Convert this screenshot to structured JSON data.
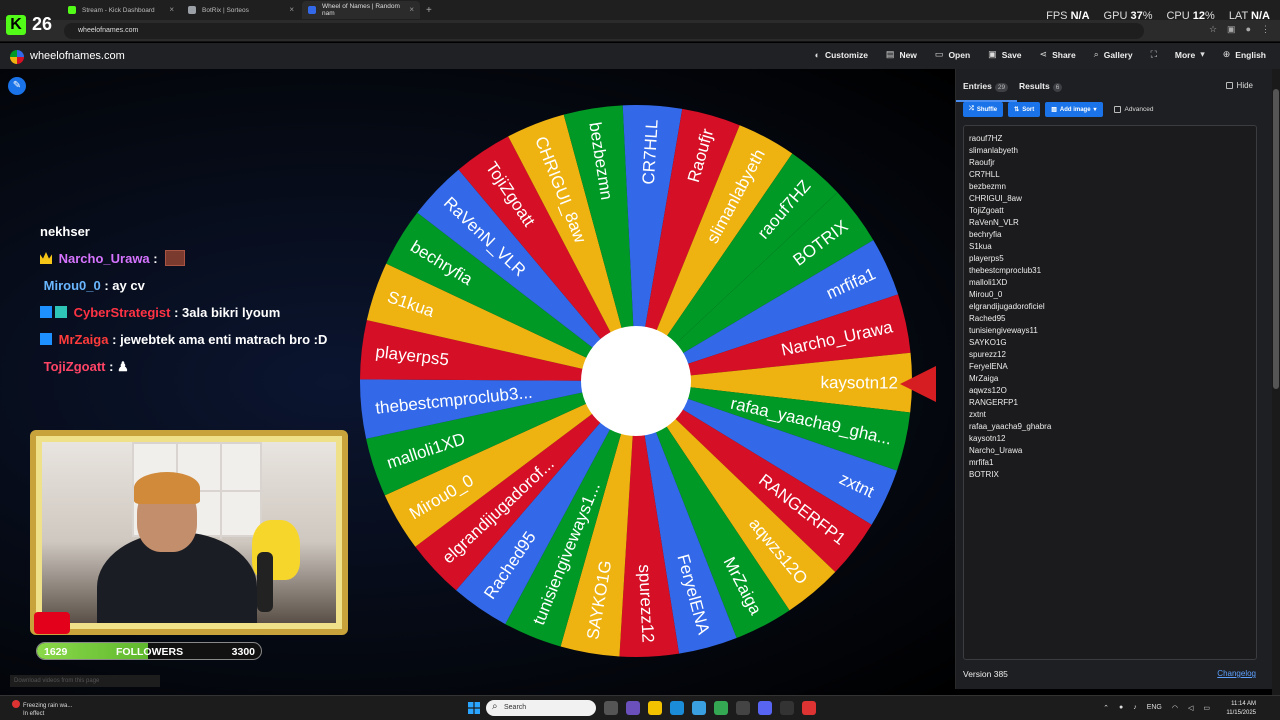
{
  "browser": {
    "tabs": [
      {
        "label": "Stream - Kick Dashboard",
        "color": "#53fc18"
      },
      {
        "label": "BotRix | Sorteos",
        "color": "#9aa0a6"
      },
      {
        "label": "Wheel of Names | Random nam",
        "color": "#3369e8"
      }
    ],
    "url": "wheelofnames.com"
  },
  "overlay": {
    "kick_logo": "K",
    "viewer_count": "26",
    "stats": {
      "fps_label": "FPS",
      "fps": "N/A",
      "gpu_label": "GPU",
      "gpu": "37",
      "cpu_label": "CPU",
      "cpu": "12",
      "pct": "%",
      "lat_label": "LAT",
      "lat": "N/A"
    }
  },
  "site": {
    "name": "wheelofnames.com",
    "nav": {
      "customize": "Customize",
      "new": "New",
      "open": "Open",
      "save": "Save",
      "share": "Share",
      "gallery": "Gallery",
      "more": "More",
      "language": "English"
    }
  },
  "chat": {
    "partial_line": "nekhser",
    "messages": [
      {
        "user": "Narcho_Urawa",
        "sep": ":",
        "text": ""
      },
      {
        "user": "Mirou0_0",
        "sep": ":",
        "text": "ay cv"
      },
      {
        "user": "CyberStrategist",
        "sep": ":",
        "text": "3ala bikri lyoum"
      },
      {
        "user": "MrZaiga",
        "sep": ":",
        "text": "jewebtek ama enti matrach bro :D"
      },
      {
        "user": "TojiZgoatt",
        "sep": ":",
        "text": ""
      }
    ]
  },
  "followers": {
    "current": "1629",
    "label": "FOLLOWERS",
    "goal": "3300",
    "progress": 0.4936
  },
  "download_hint": "Download videos from this page",
  "wheel": {
    "colors": [
      "#009925",
      "#3369e8",
      "#d50f25",
      "#eeb211"
    ],
    "segments": [
      "BOTRIX",
      "mrfifa1",
      "Narcho_Urawa",
      "kaysotn12",
      "rafaa_yaacha9_gha...",
      "zxtnt",
      "RANGERFP1",
      "aqwzs12O",
      "MrZaiga",
      "FeryelENA",
      "spurezz12",
      "SAYKO1G",
      "tunisiengiveways1...",
      "Rached95",
      "elgrandijugadorof...",
      "Mirou0_0",
      "malloli1XD",
      "thebestcmproclub3...",
      "playerps5",
      "S1kua",
      "bechryfia",
      "RaVenN_VLR",
      "TojiZgoatt",
      "CHRIGUI_8aw",
      "bezbezmn",
      "CR7HLL",
      "Raoufjr",
      "slimanlabyeth",
      "raouf7HZ"
    ]
  },
  "panel": {
    "entries_tab": "Entries",
    "entries_count": "29",
    "results_tab": "Results",
    "results_count": "6",
    "hide": "Hide",
    "shuffle": "Shuffle",
    "sort": "Sort",
    "add_image": "Add image",
    "advanced": "Advanced",
    "entries": [
      "raouf7HZ",
      "slimanlabyeth",
      "Raoufjr",
      "CR7HLL",
      "bezbezmn",
      "CHRIGUI_8aw",
      "TojiZgoatt",
      "RaVenN_VLR",
      "bechryfia",
      "S1kua",
      "playerps5",
      "thebestcmproclub31",
      "malloli1XD",
      "Mirou0_0",
      "elgrandijugadoroficiel",
      "Rached95",
      "tunisiengiveways11",
      "SAYKO1G",
      "spurezz12",
      "FeryelENA",
      "MrZaiga",
      "aqwzs12O",
      "RANGERFP1",
      "zxtnt",
      "rafaa_yaacha9_ghabra",
      "kaysotn12",
      "Narcho_Urawa",
      "mrfifa1",
      "BOTRIX"
    ],
    "version": "Version 385",
    "changelog": "Changelog"
  },
  "taskbar": {
    "weather_title": "Freezing rain wa...",
    "weather_sub": "In effect",
    "search": "Search",
    "lang": "ENG",
    "time": "11:14 AM",
    "date": "11/15/2025"
  }
}
